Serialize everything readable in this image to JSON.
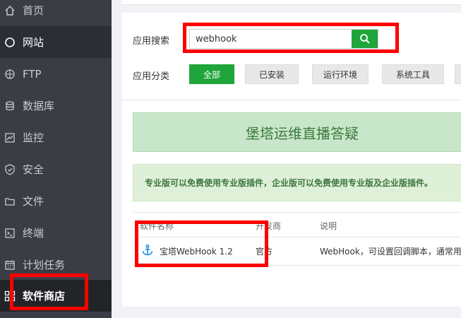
{
  "sidebar": {
    "items": [
      {
        "label": "首页",
        "icon": "home-icon"
      },
      {
        "label": "网站",
        "icon": "globe-icon"
      },
      {
        "label": "FTP",
        "icon": "ftp-icon"
      },
      {
        "label": "数据库",
        "icon": "database-icon"
      },
      {
        "label": "监控",
        "icon": "monitor-icon"
      },
      {
        "label": "安全",
        "icon": "shield-icon"
      },
      {
        "label": "文件",
        "icon": "folder-icon"
      },
      {
        "label": "终端",
        "icon": "terminal-icon"
      },
      {
        "label": "计划任务",
        "icon": "calendar-icon"
      },
      {
        "label": "软件商店",
        "icon": "apps-icon"
      }
    ]
  },
  "search": {
    "label": "应用搜索",
    "value": "webhook"
  },
  "category": {
    "label": "应用分类",
    "buttons": [
      "全部",
      "已安装",
      "运行环境",
      "系统工具"
    ]
  },
  "banner": {
    "text": "堡塔运维直播答疑"
  },
  "notice": {
    "text": "专业版可以免费使用专业版插件，企业版可以免费使用专业版及企业版插件。"
  },
  "table": {
    "headers": [
      "软件名称",
      "开发商",
      "说明"
    ],
    "rows": [
      {
        "name": "宝塔WebHook 1.2",
        "developer": "官方",
        "description": "WebHook，可设置回调脚本，通常用"
      }
    ]
  },
  "colors": {
    "accent": "#20a53a",
    "highlight": "#ff0000"
  }
}
